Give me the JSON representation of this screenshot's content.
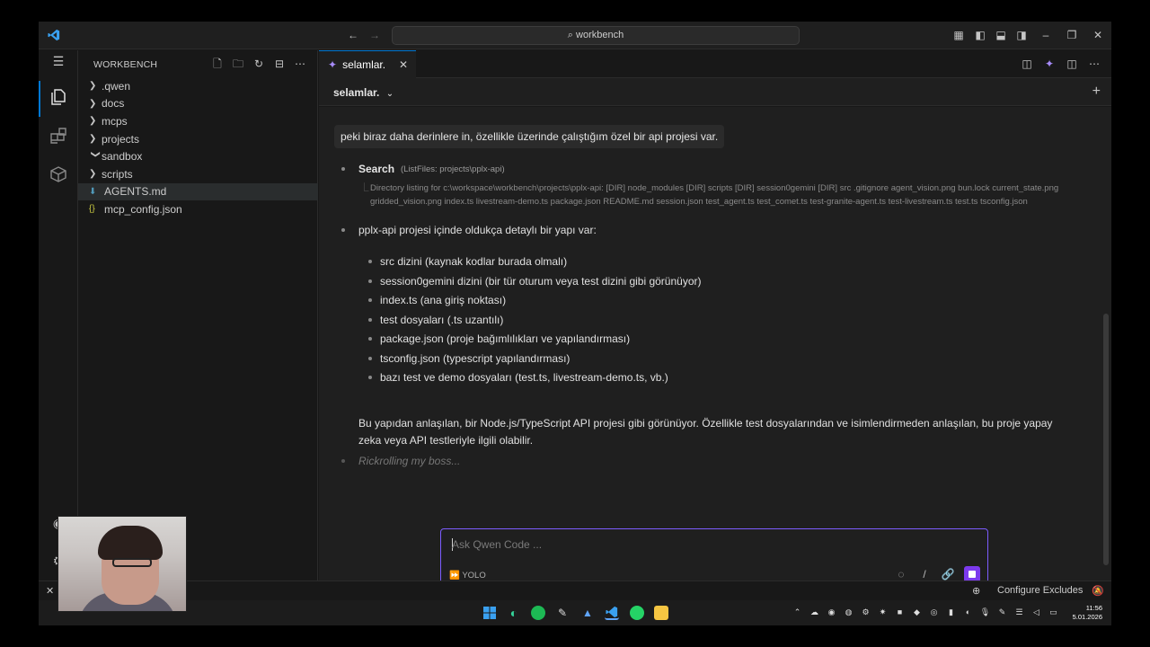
{
  "titlebar": {
    "search": "workbench"
  },
  "sidebar": {
    "title": "WORKBENCH",
    "items": [
      {
        "label": ".qwen",
        "kind": "folder",
        "open": false
      },
      {
        "label": "docs",
        "kind": "folder",
        "open": false
      },
      {
        "label": "mcps",
        "kind": "folder",
        "open": false
      },
      {
        "label": "projects",
        "kind": "folder",
        "open": false
      },
      {
        "label": "sandbox",
        "kind": "folder",
        "open": true
      },
      {
        "label": "scripts",
        "kind": "folder",
        "open": false
      },
      {
        "label": "AGENTS.md",
        "kind": "md",
        "selected": true
      },
      {
        "label": "mcp_config.json",
        "kind": "json"
      }
    ]
  },
  "tab": {
    "label": "selamlar."
  },
  "chat": {
    "title": "selamlar.",
    "user_message": "peki biraz daha derinlere in, özellikle üzerinde çalıştığım özel bir api projesi var.",
    "tool": {
      "name": "Search",
      "args": "(ListFiles: projects\\pplx-api)",
      "output": "Directory listing for c:\\workspace\\workbench\\projects\\pplx-api: [DIR] node_modules [DIR] scripts [DIR] session0gemini [DIR] src .gitignore agent_vision.png bun.lock current_state.png gridded_vision.png index.ts livestream-demo.ts package.json README.md session.json test_agent.ts test_comet.ts test-granite-agent.ts test-livestream.ts test.ts tsconfig.json"
    },
    "answer_intro": "pplx-api projesi içinde oldukça detaylı bir yapı var:",
    "answer_items": [
      "src dizini (kaynak kodlar burada olmalı)",
      "session0gemini dizini (bir tür oturum veya test dizini gibi görünüyor)",
      "index.ts (ana giriş noktası)",
      "test dosyaları (.ts uzantılı)",
      "package.json (proje bağımlılıkları ve yapılandırması)",
      "tsconfig.json (typescript yapılandırması)",
      "bazı test ve demo dosyaları (test.ts, livestream-demo.ts, vb.)"
    ],
    "answer_summary": "Bu yapıdan anlaşılan, bir Node.js/TypeScript API projesi gibi görünüyor. Özellikle test dosyalarından ve isimlendirmeden anlaşılan, bu proje yapay zeka veya API testleriyle ilgili olabilir.",
    "thinking": "Rickrolling my boss...",
    "composer": {
      "placeholder": "Ask Qwen Code ...",
      "mode": "YOLO"
    }
  },
  "statusbar": {
    "configure_excludes": "Configure Excludes"
  },
  "taskbar": {
    "time": "11:56",
    "date": "5.01.2026"
  },
  "colors": {
    "accent": "#7c5cff",
    "tab_border": "#0078d4",
    "stop": "#7c3aed"
  }
}
